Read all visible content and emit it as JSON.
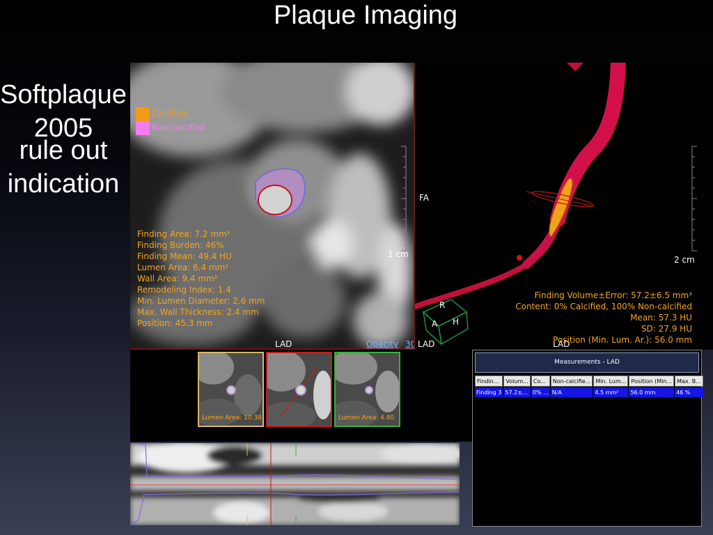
{
  "slide": {
    "title": "Plaque Imaging",
    "left_line1": "Softplaque 2005",
    "left_line2": "rule out indication"
  },
  "cross_section": {
    "legend": [
      {
        "label": "Calcified",
        "color": "#f39a16"
      },
      {
        "label": "Non-calcified",
        "color": "#f47bf0"
      }
    ],
    "measurements": [
      "Finding Area: 7.2 mm²",
      "Finding Burden: 46%",
      "Finding Mean: 49.4 HU",
      "Lumen Area: 6.4 mm²",
      "Wall Area: 9.4 mm²",
      "Remodeling Index: 1.4",
      "Min. Lumen Diameter: 2.6 mm",
      "Max. Wall Thickness: 2.4 mm",
      "Position:  45.3 mm"
    ],
    "orientation_label": "FA",
    "scale_label": "1 cm",
    "vessel_label": "LAD",
    "opacity_label": "Opacity",
    "opacity_value": "30"
  },
  "volume_render": {
    "info": [
      "Finding Volume±Error: 57.2±6.5 mm³",
      "Content: 0% Calcified, 100% Non-calcified",
      "Mean: 57.3 HU",
      "SD: 27.9 HU",
      "Position (Min. Lum. Ar.): 56.0 mm"
    ],
    "scale_label": "2 cm",
    "vessel_label": "LAD",
    "orientation_cube": {
      "r": "R",
      "a": "A",
      "h": "H"
    }
  },
  "thumbnails": [
    {
      "caption": "Lumen Area: 10.38",
      "border_color": "#d8b86a"
    },
    {
      "caption": "",
      "border_color": "#c41c1c"
    },
    {
      "caption": "Lumen Area: 4.80",
      "border_color": "#39b23a"
    }
  ],
  "measurements_table": {
    "title": "Measurements - LAD",
    "columns": [
      "Findin...",
      "Volum...",
      "Co...",
      "Non-calcifie...",
      "Min. Lum...",
      "Position (Min...",
      "Max. B..."
    ],
    "rows": [
      [
        "Finding 3",
        "57.2±...",
        "0% ...",
        "N/A",
        "4.5 mm²",
        "56.0 mm",
        "46 %"
      ]
    ]
  }
}
